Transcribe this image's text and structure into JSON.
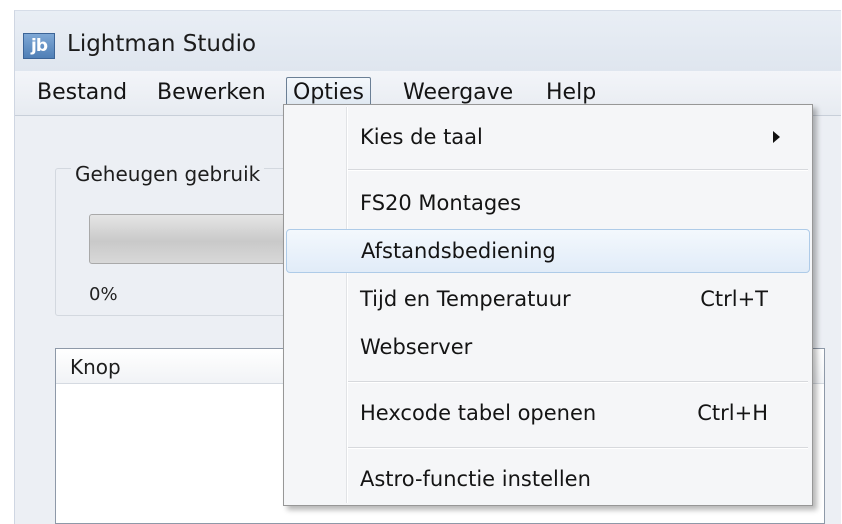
{
  "window": {
    "title": "Lightman Studio",
    "logo_text": "jb"
  },
  "menubar": {
    "items": [
      {
        "label": "Bestand"
      },
      {
        "label": "Bewerken"
      },
      {
        "label": "Opties",
        "active": true
      },
      {
        "label": "Weergave"
      },
      {
        "label": "Help"
      }
    ]
  },
  "memory": {
    "group_label": "Geheugen gebruik",
    "progress_value": "0%",
    "progress_fraction": 0
  },
  "list": {
    "columns": [
      "Knop"
    ]
  },
  "opties_menu": {
    "items": [
      {
        "label": "Kies de taal",
        "submenu": true,
        "icon": "submenu-arrow-icon"
      },
      {
        "label": "FS20 Montages"
      },
      {
        "label": "Afstandsbediening",
        "highlighted": true
      },
      {
        "label": "Tijd en Temperatuur",
        "shortcut": "Ctrl+T"
      },
      {
        "label": "Webserver"
      },
      {
        "label": "Hexcode tabel openen",
        "shortcut": "Ctrl+H"
      },
      {
        "label": "Astro-functie instellen"
      }
    ]
  },
  "colors": {
    "menu_highlight": "#e1ecf8",
    "window_bg": "#eceff4"
  }
}
